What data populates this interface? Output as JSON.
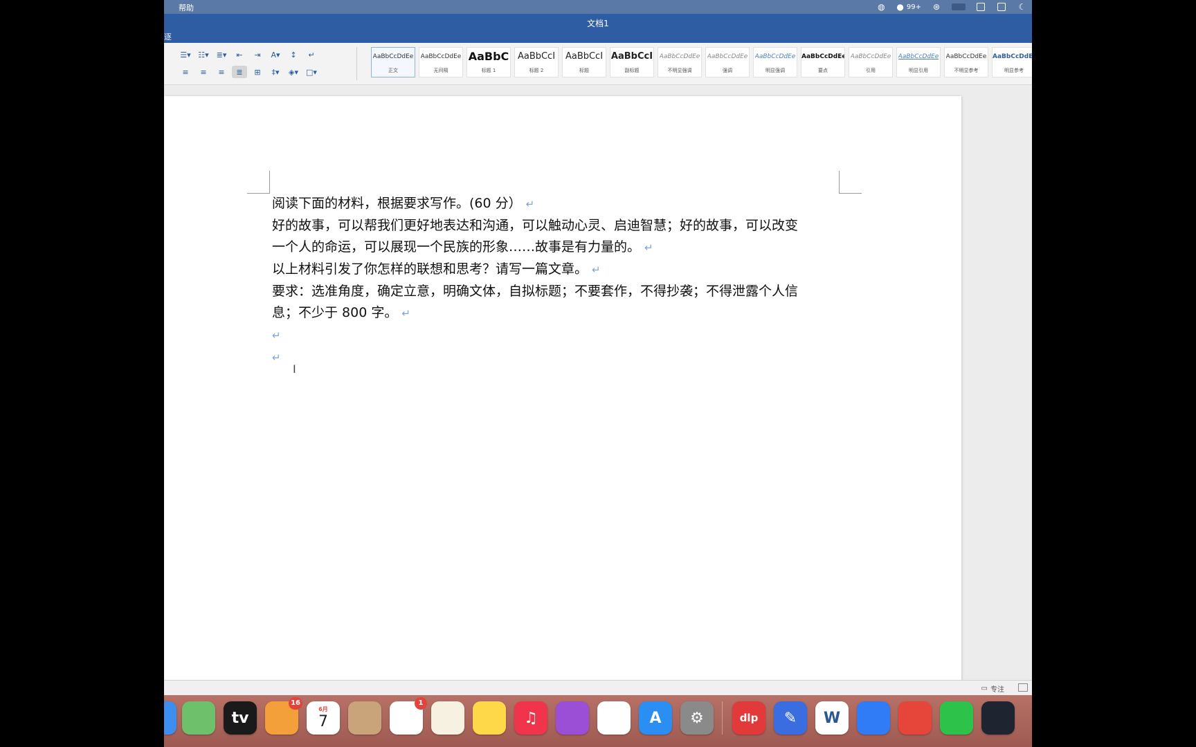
{
  "menubar": {
    "help": "帮助",
    "wechat_count": "99+"
  },
  "window": {
    "title": "文档1",
    "tab_fragment": "逐"
  },
  "ribbon": {
    "styles": [
      {
        "sample": "AaBbCcDdEe",
        "name": "正文",
        "selected": true
      },
      {
        "sample": "AaBbCcDdEe",
        "name": "无间隔"
      },
      {
        "sample": "AaBbC",
        "name": "标题 1"
      },
      {
        "sample": "AaBbCcI",
        "name": "标题 2"
      },
      {
        "sample": "AaBbCcI",
        "name": "标题"
      },
      {
        "sample": "AaBbCcI",
        "name": "副标题"
      },
      {
        "sample": "AaBbCcDdEe",
        "name": "不明显强调"
      },
      {
        "sample": "AaBbCcDdEe",
        "name": "强调"
      },
      {
        "sample": "AaBbCcDdEe",
        "name": "明显强调"
      },
      {
        "sample": "AaBbCcDdEe",
        "name": "要点"
      },
      {
        "sample": "AaBbCcDdEe",
        "name": "引用"
      },
      {
        "sample": "AaBbCcDdEe",
        "name": "明显引用"
      },
      {
        "sample": "AaBbCcDdEe",
        "name": "不明显参考"
      },
      {
        "sample": "AaBbCcDdEe",
        "name": "明显参考"
      }
    ]
  },
  "document": {
    "paragraphs": [
      "阅读下面的材料，根据要求写作。(60 分）",
      "好的故事，可以帮我们更好地表达和沟通，可以触动心灵、启迪智慧；好的故事，可以改变",
      "一个人的命运，可以展现一个民族的形象……故事是有力量的。",
      "以上材料引发了你怎样的联想和思考？请写一篇文章。",
      "要求：选准角度，确定立意，明确文体，自拟标题；不要套作，不得抄袭；不得泄露个人信",
      "息；不少于 800 字。"
    ],
    "paragraph_mark": "↵"
  },
  "statusbar": {
    "focus_label": "专注"
  },
  "dock": {
    "apps": [
      {
        "name": "finder",
        "color": "#3c8ff0"
      },
      {
        "name": "maps",
        "color": "#6fc06a"
      },
      {
        "name": "apple-tv",
        "label": "tv",
        "color": "#1a1a1a"
      },
      {
        "name": "photos",
        "color": "#f4a03a",
        "badge": "16"
      },
      {
        "name": "calendar",
        "label": "7",
        "month": "6月",
        "color": "#ffffff"
      },
      {
        "name": "contacts",
        "color": "#c9a37a"
      },
      {
        "name": "reminders",
        "color": "#ffffff",
        "badge": "1"
      },
      {
        "name": "pages",
        "color": "#f7f1e2"
      },
      {
        "name": "notes",
        "color": "#ffd84a"
      },
      {
        "name": "music",
        "label": "♫",
        "color": "#f0344c"
      },
      {
        "name": "podcasts",
        "color": "#9b4fd6"
      },
      {
        "name": "numbers",
        "color": "#ffffff"
      },
      {
        "name": "app-store",
        "label": "A",
        "color": "#2a8ef2"
      },
      {
        "name": "system-settings",
        "label": "⚙",
        "color": "#8a8a8a"
      },
      {
        "name": "dlp-app",
        "label": "dlp",
        "color": "#e23a3a"
      },
      {
        "name": "pencil-app",
        "label": "✎",
        "color": "#3a6ee0"
      },
      {
        "name": "microsoft-word",
        "label": "W",
        "color": "#ffffff"
      },
      {
        "name": "feishu",
        "color": "#2f7cf6"
      },
      {
        "name": "xmind",
        "color": "#e6453a"
      },
      {
        "name": "wechat",
        "color": "#2dc24a"
      },
      {
        "name": "obs",
        "color": "#1e2430"
      }
    ]
  }
}
